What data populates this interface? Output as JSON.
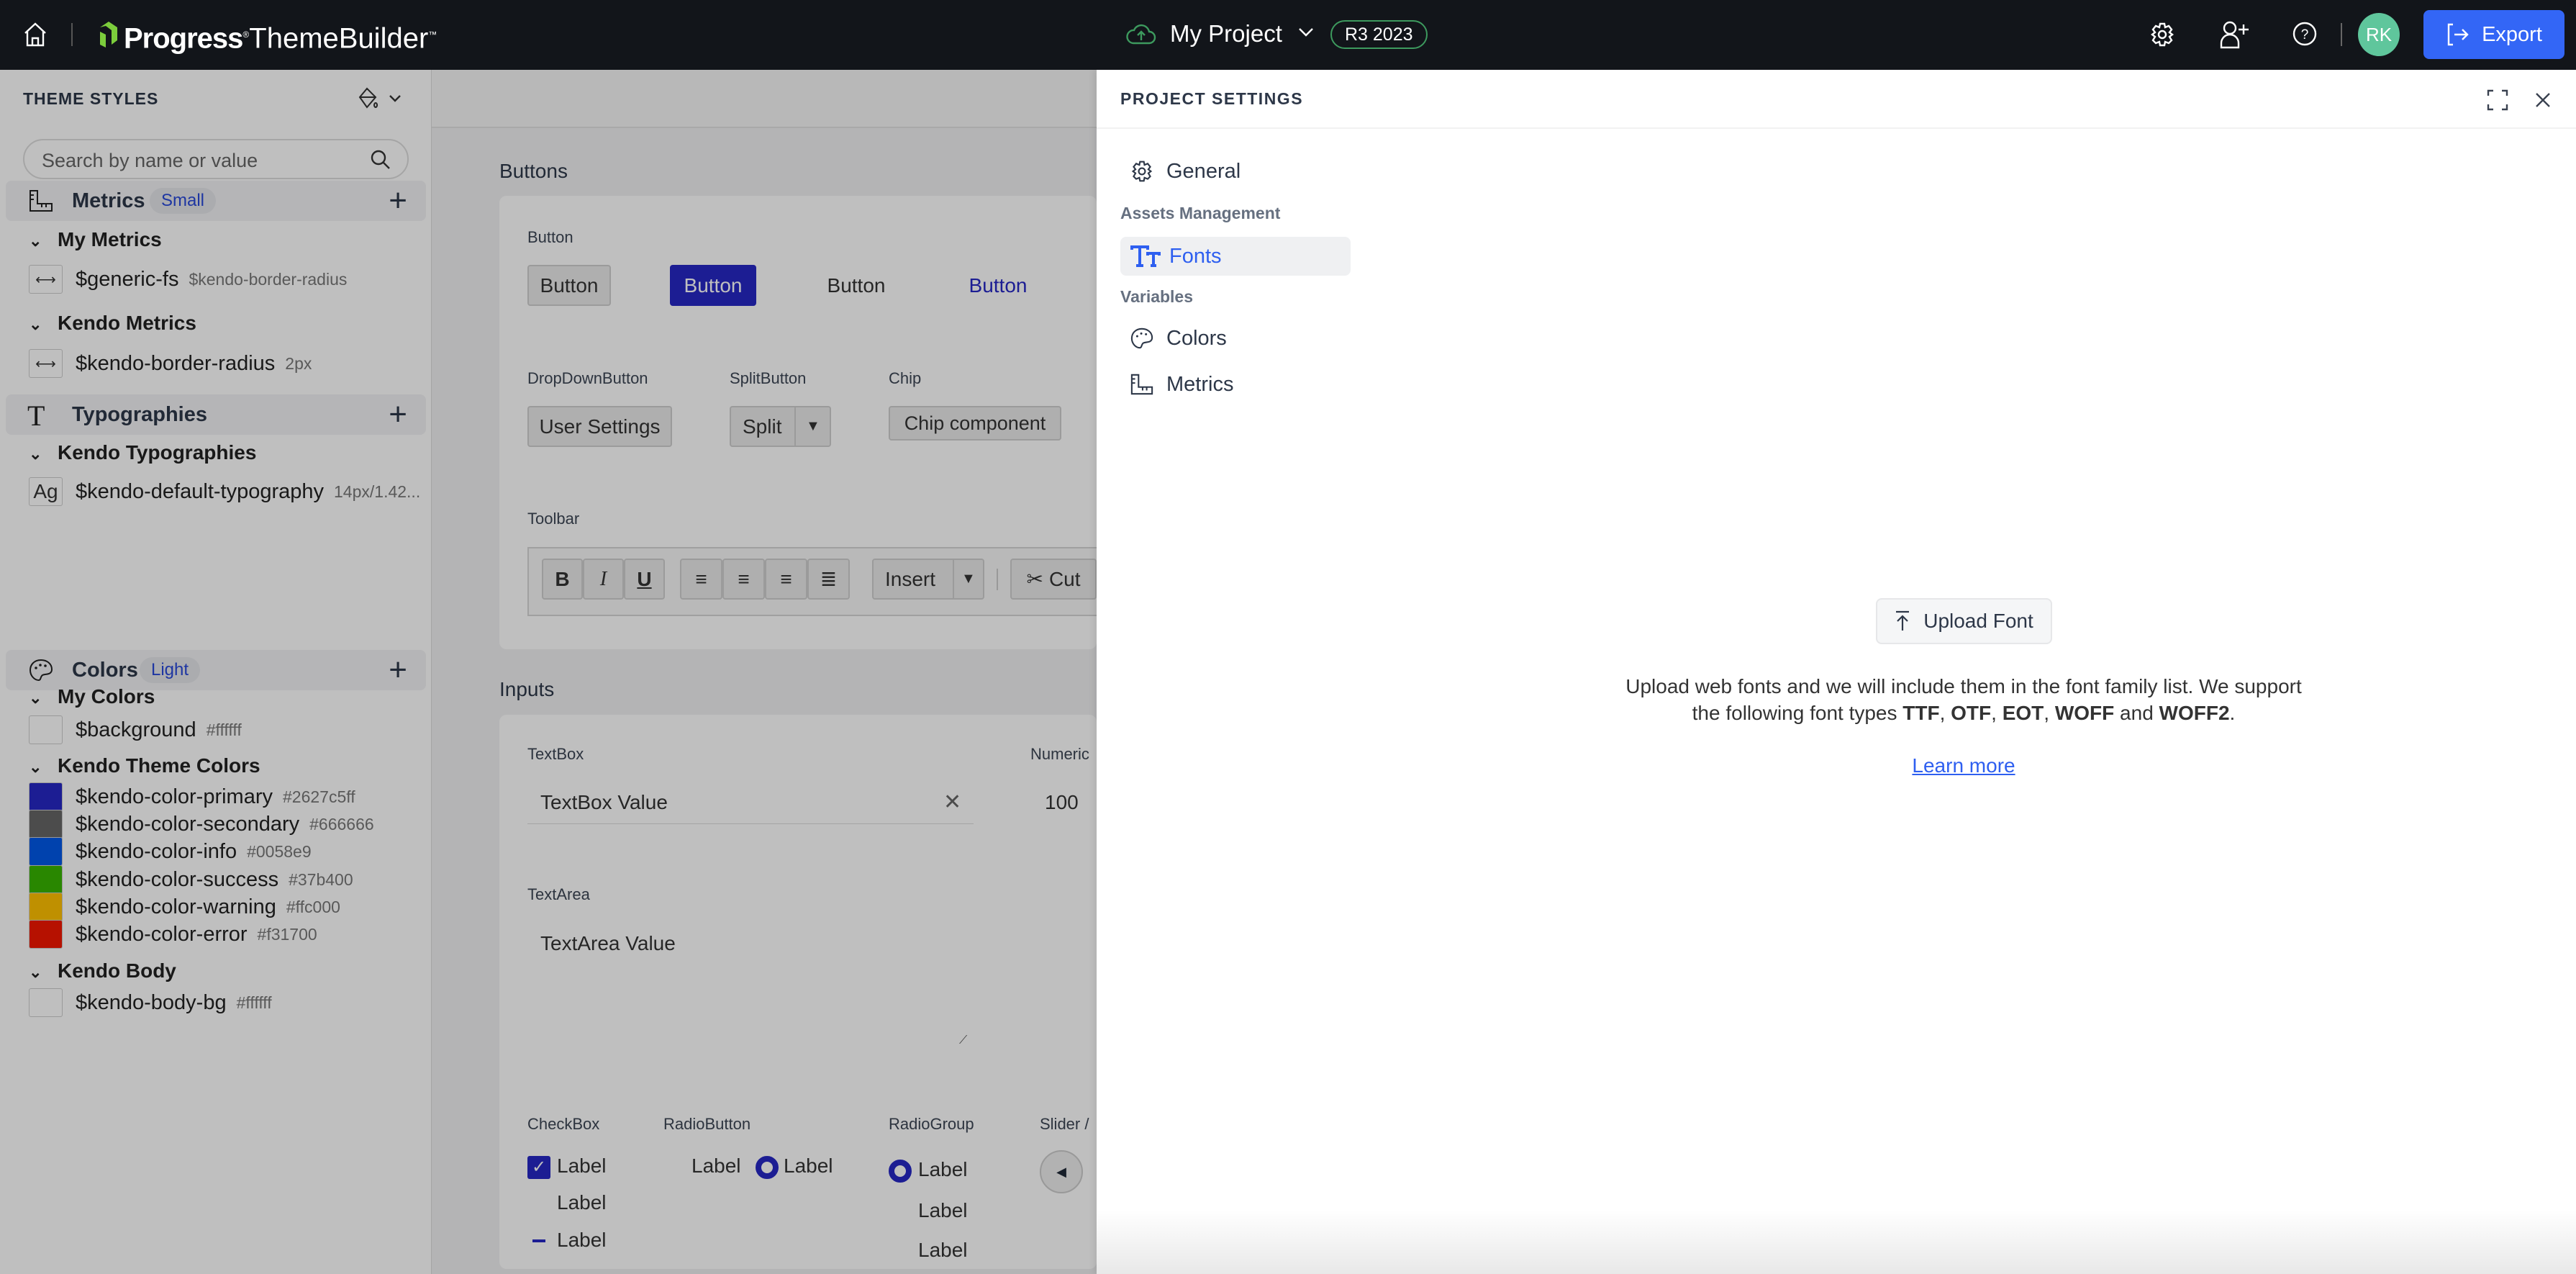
{
  "header": {
    "brand": "Progress",
    "product": "ThemeBuilder",
    "project_name": "My Project",
    "version_badge": "R3 2023",
    "avatar_initials": "RK",
    "export_label": "Export",
    "accent": "#3366f6",
    "avatar_color": "#5fc69c",
    "logo_color": "#7ccd3c"
  },
  "sidebar": {
    "title": "THEME STYLES",
    "search_placeholder": "Search by name or value",
    "metrics": {
      "label": "Metrics",
      "badge": "Small",
      "groups": [
        {
          "label": "My Metrics",
          "items": [
            {
              "name": "$generic-fs",
              "value": "$kendo-border-radius"
            }
          ]
        },
        {
          "label": "Kendo Metrics",
          "items": [
            {
              "name": "$kendo-border-radius",
              "value": "2px"
            }
          ]
        }
      ]
    },
    "typographies": {
      "label": "Typographies",
      "group": "Kendo Typographies",
      "item": {
        "icon_text": "Ag",
        "name": "$kendo-default-typography",
        "value": "14px/1.42..."
      }
    },
    "colors": {
      "label": "Colors",
      "badge": "Light",
      "my_group": "My Colors",
      "my_items": [
        {
          "name": "$background",
          "value": "#ffffff",
          "color": "#ffffff"
        }
      ],
      "theme_group": "Kendo Theme Colors",
      "theme_items": [
        {
          "name": "$kendo-color-primary",
          "value": "#2627c5ff",
          "color": "#2627c5"
        },
        {
          "name": "$kendo-color-secondary",
          "value": "#666666",
          "color": "#666666"
        },
        {
          "name": "$kendo-color-info",
          "value": "#0058e9",
          "color": "#0058e9"
        },
        {
          "name": "$kendo-color-success",
          "value": "#37b400",
          "color": "#37b400"
        },
        {
          "name": "$kendo-color-warning",
          "value": "#ffc000",
          "color": "#ffc000"
        },
        {
          "name": "$kendo-color-error",
          "value": "#f31700",
          "color": "#f31700"
        }
      ],
      "body_group": "Kendo Body",
      "body_items": [
        {
          "name": "$kendo-body-bg",
          "value": "#ffffff",
          "color": "#ffffff"
        }
      ]
    }
  },
  "canvas": {
    "buttons_title": "Buttons",
    "button_label": "Button",
    "buttons": [
      "Button",
      "Button",
      "Button",
      "Button"
    ],
    "dropdown_label": "DropDownButton",
    "dropdown_value": "User Settings",
    "split_label": "SplitButton",
    "split_value": "Split",
    "chip_label": "Chip",
    "chip_value": "Chip component",
    "toolbar_label": "Toolbar",
    "toolbar": {
      "bold": "B",
      "italic": "I",
      "underline": "U",
      "insert": "Insert",
      "cut": "Cut"
    },
    "inputs_title": "Inputs",
    "textbox_label": "TextBox",
    "textbox_value": "TextBox Value",
    "numeric_label": "Numeric",
    "numeric_value": "100",
    "textarea_label": "TextArea",
    "textarea_value": "TextArea Value",
    "checkbox_label": "CheckBox",
    "checkbox_items": [
      "Label",
      "Label",
      "Label"
    ],
    "radio_label": "RadioButton",
    "radio_items": [
      "Label",
      "Label"
    ],
    "radiogroup_label": "RadioGroup",
    "radiogroup_items": [
      "Label",
      "Label",
      "Label"
    ],
    "slider_label": "Slider /"
  },
  "panel": {
    "title": "PROJECT SETTINGS",
    "nav": {
      "general": "General",
      "assets_heading": "Assets Management",
      "fonts": "Fonts",
      "variables_heading": "Variables",
      "colors": "Colors",
      "metrics": "Metrics"
    },
    "upload_button": "Upload Font",
    "description_1": "Upload web fonts and we will include them in the font family list. We support",
    "description_2a": "the following font types ",
    "ttf": "TTF",
    ", ": ", ",
    "otf": "OTF",
    "eot": "EOT",
    "woff": "WOFF",
    "and": " and ",
    "woff2": "WOFF2",
    ".": ".",
    "learn_more": "Learn more"
  }
}
